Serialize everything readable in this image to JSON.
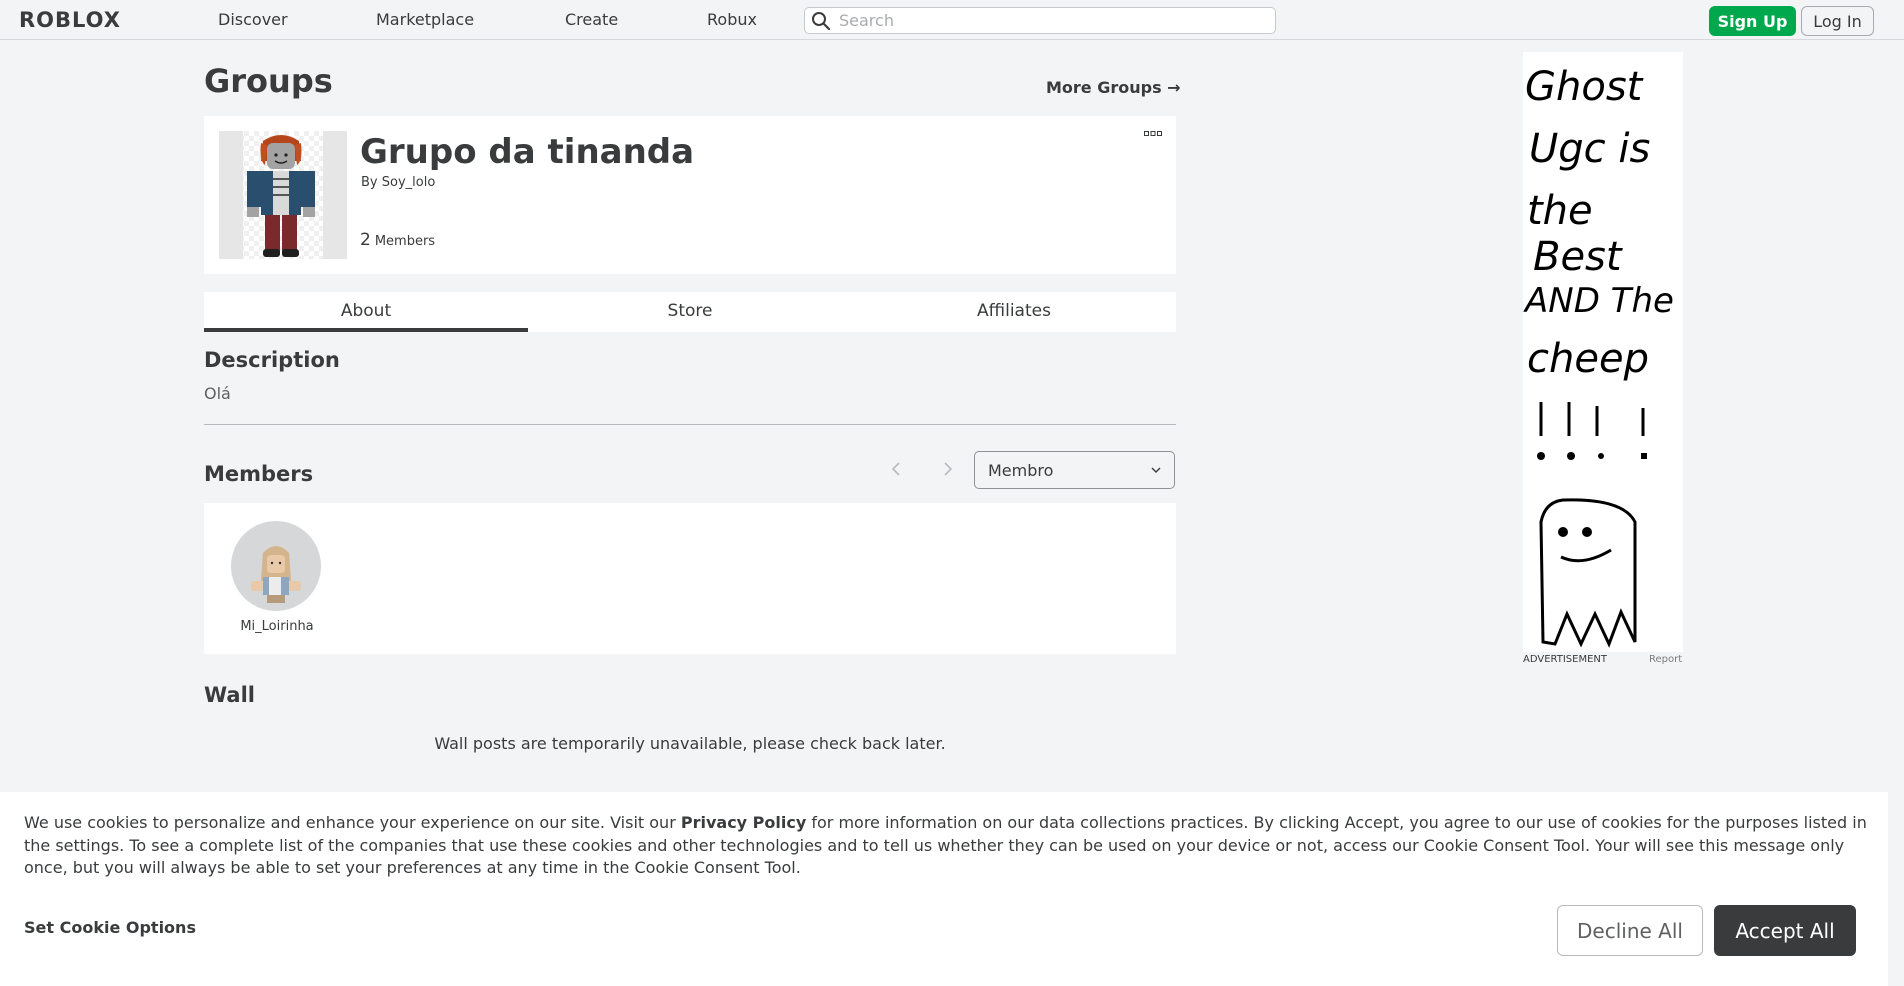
{
  "topnav": {
    "logo": "ROBLOX",
    "links": [
      "Discover",
      "Marketplace",
      "Create",
      "Robux"
    ],
    "search_placeholder": "Search",
    "signup_label": "Sign Up",
    "login_label": "Log In"
  },
  "page": {
    "title": "Groups",
    "more_groups": "More Groups →"
  },
  "group": {
    "name": "Grupo da tinanda",
    "by_prefix": "By",
    "owner": "Soy_lolo",
    "member_count": "2",
    "member_label": "Members"
  },
  "tabs": [
    "About",
    "Store",
    "Affiliates"
  ],
  "description": {
    "title": "Description",
    "text": "Olá"
  },
  "members": {
    "title": "Members",
    "role_selected": "Membro",
    "list": [
      {
        "name": "Mi_Loirinha"
      }
    ]
  },
  "wall": {
    "title": "Wall",
    "message": "Wall posts are temporarily unavailable, please check back later."
  },
  "ad": {
    "label": "ADVERTISEMENT",
    "report": "Report",
    "lines": [
      "Ghost",
      "Ugc is",
      "the",
      "Best",
      "AND The",
      "cheep"
    ]
  },
  "cookie": {
    "text_before": "We use cookies to personalize and enhance your experience on our site. Visit our ",
    "privacy_link": "Privacy Policy",
    "text_after": " for more information on our data collections practices. By clicking Accept, you agree to our use of cookies for the purposes listed in the settings. To see a complete list of the companies that use these cookies and other technologies and to tell us whether they can be used on your device or not, access our Cookie Consent Tool. Your will see this message only once, but you will always be able to set your preferences at any time in the Cookie Consent Tool.",
    "set_options": "Set Cookie Options",
    "decline": "Decline All",
    "accept": "Accept All"
  },
  "colors": {
    "page_bg": "#f2f4f5",
    "text": "#393b3d",
    "signup_green": "#00a84d",
    "accept_dark": "#393b3d"
  }
}
